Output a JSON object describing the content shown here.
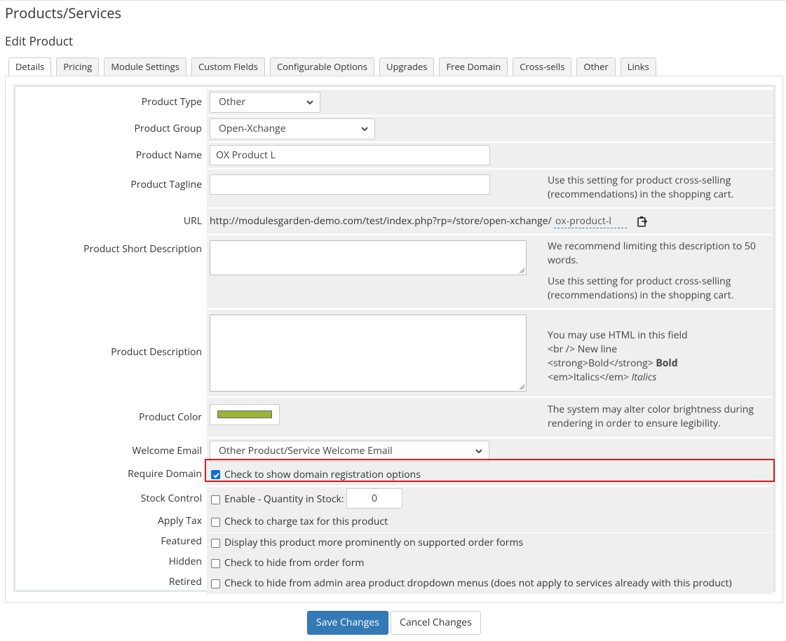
{
  "page": {
    "title": "Products/Services",
    "subtitle": "Edit Product"
  },
  "tabs": [
    {
      "label": "Details",
      "active": true
    },
    {
      "label": "Pricing"
    },
    {
      "label": "Module Settings"
    },
    {
      "label": "Custom Fields"
    },
    {
      "label": "Configurable Options"
    },
    {
      "label": "Upgrades"
    },
    {
      "label": "Free Domain"
    },
    {
      "label": "Cross-sells"
    },
    {
      "label": "Other"
    },
    {
      "label": "Links"
    }
  ],
  "form": {
    "product_type": {
      "label": "Product Type",
      "value": "Other"
    },
    "product_group": {
      "label": "Product Group",
      "value": "Open-Xchange"
    },
    "product_name": {
      "label": "Product Name",
      "value": "OX Product L"
    },
    "product_tagline": {
      "label": "Product Tagline",
      "value": "",
      "hint": "Use this setting for product cross-selling (recommendations) in the shopping cart."
    },
    "url": {
      "label": "URL",
      "base": "http://modulesgarden-demo.com/test/index.php?rp=/store/open-xchange/",
      "slug": "ox-product-l"
    },
    "short_description": {
      "label": "Product Short Description",
      "value": "",
      "hint1": "We recommend limiting this description to 50 words.",
      "hint2": "Use this setting for product cross-selling (recommendations) in the shopping cart."
    },
    "description": {
      "label": "Product Description",
      "value": "",
      "hint_line1": "You may use HTML in this field",
      "hint_line2": "<br /> New line",
      "hint_line3a": "<strong>Bold</strong>",
      "hint_line3b": "Bold",
      "hint_line4a": "<em>Italics</em>",
      "hint_line4b": "Italics"
    },
    "product_color": {
      "label": "Product Color",
      "color": "#9bb437",
      "hint": "The system may alter color brightness during rendering in order to ensure legibility."
    },
    "welcome_email": {
      "label": "Welcome Email",
      "value": "Other Product/Service Welcome Email"
    },
    "require_domain": {
      "label": "Require Domain",
      "text": "Check to show domain registration options",
      "checked": true
    },
    "stock_control": {
      "label": "Stock Control",
      "text": "Enable - Quantity in Stock:",
      "quantity": "0",
      "checked": false
    },
    "apply_tax": {
      "label": "Apply Tax",
      "text": "Check to charge tax for this product",
      "checked": false
    },
    "featured": {
      "label": "Featured",
      "text": "Display this product more prominently on supported order forms",
      "checked": false
    },
    "hidden": {
      "label": "Hidden",
      "text": "Check to hide from order form",
      "checked": false
    },
    "retired": {
      "label": "Retired",
      "text": "Check to hide from admin area product dropdown menus (does not apply to services already with this product)",
      "checked": false
    }
  },
  "buttons": {
    "save": "Save Changes",
    "cancel": "Cancel Changes"
  },
  "colors": {
    "primary": "#337ab7",
    "highlight": "#e0141e",
    "checkbox_checked": "#0b6fd3"
  }
}
